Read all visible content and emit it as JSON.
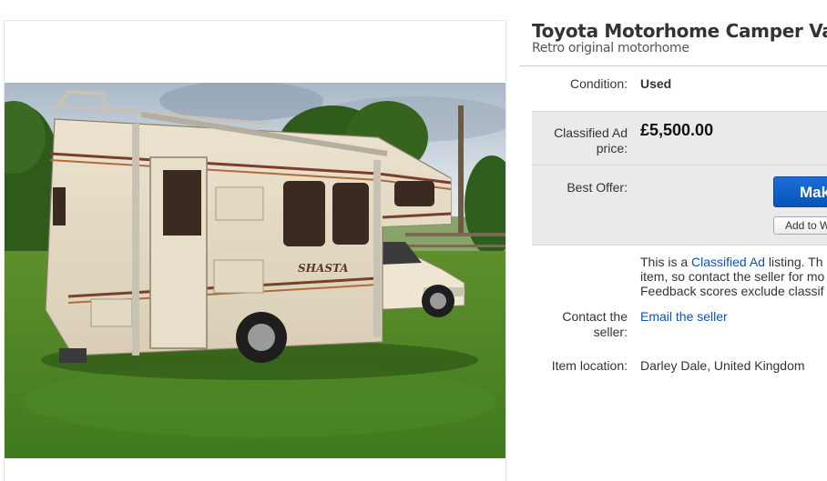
{
  "listing": {
    "title": "Toyota Motorhome Camper Van",
    "subtitle": "Retro original motorhome"
  },
  "condition": {
    "label": "Condition:",
    "value": "Used"
  },
  "price": {
    "label_line1": "Classified Ad",
    "label_line2": "price:",
    "value": "£5,500.00"
  },
  "best_offer": {
    "label": "Best Offer:",
    "make_offer_label": "Mak",
    "watch_label": "Add to W"
  },
  "classified_notice": {
    "line1_prefix": "This is a ",
    "line1_link": "Classified Ad",
    "line1_suffix": " listing. Th",
    "line2": "item, so contact the seller for mo",
    "line3": "Feedback scores exclude classif"
  },
  "contact": {
    "label_line1": "Contact the",
    "label_line2": "seller:",
    "link": "Email the seller"
  },
  "location": {
    "label": "Item location:",
    "value": "Darley Dale, United Kingdom"
  },
  "photo": {
    "decal_text": "SHASTA"
  },
  "colors": {
    "accent_blue": "#0654ba",
    "panel_grey": "#eaeaea"
  }
}
